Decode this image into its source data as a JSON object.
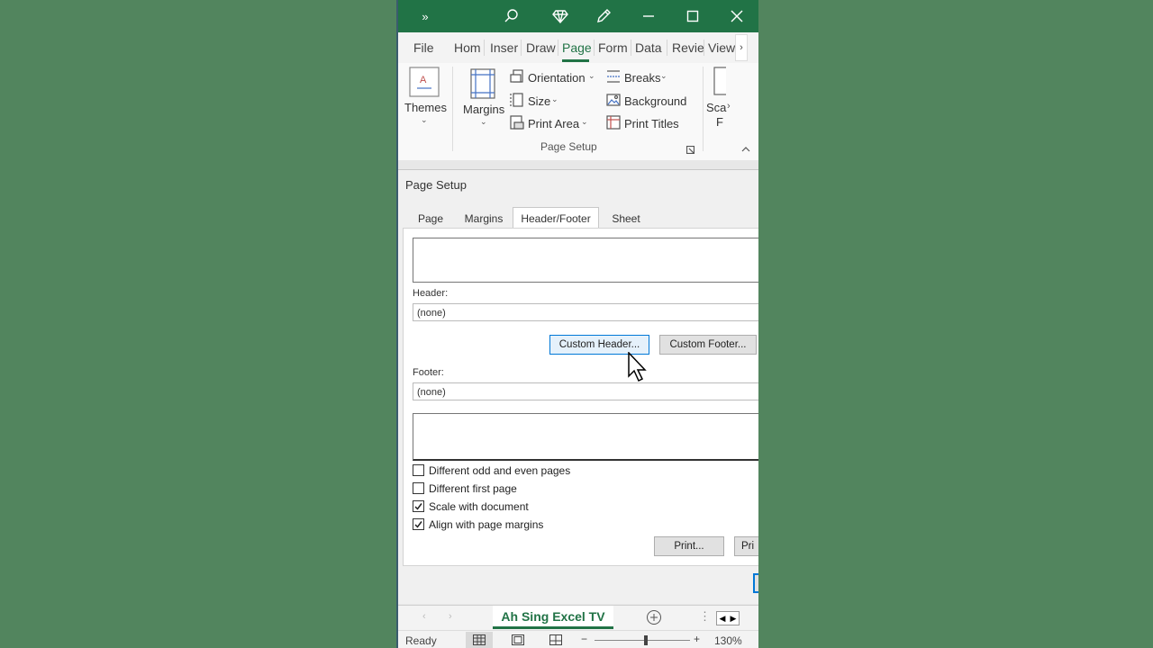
{
  "ribbon_tabs": [
    "File",
    "Hom",
    "Inser",
    "Draw",
    "Page",
    "Form",
    "Data",
    "Revie",
    "View"
  ],
  "ribbon": {
    "themes": "Themes",
    "margins": "Margins",
    "orientation": "Orientation",
    "size": "Size",
    "print_area": "Print Area",
    "breaks": "Breaks",
    "background": "Background",
    "print_titles": "Print Titles",
    "scale_partial_1": "Sca",
    "scale_partial_2": "F",
    "group_label": "Page Setup"
  },
  "dialog": {
    "title": "Page Setup",
    "tabs": [
      "Page",
      "Margins",
      "Header/Footer",
      "Sheet"
    ],
    "header_label": "Header:",
    "header_value": "(none)",
    "custom_header": "Custom Header...",
    "custom_footer": "Custom Footer...",
    "footer_label": "Footer:",
    "footer_value": "(none)",
    "options": [
      {
        "label": "Different odd and even pages",
        "checked": false
      },
      {
        "label": "Different first page",
        "checked": false
      },
      {
        "label": "Scale with document",
        "checked": true
      },
      {
        "label": "Align with page margins",
        "checked": true
      }
    ],
    "print_button": "Print...",
    "print_preview_partial": "Pri"
  },
  "sheet_tab": "Ah Sing Excel TV",
  "status": {
    "ready": "Ready",
    "zoom": "130%"
  },
  "colors": {
    "accent": "#217346",
    "background": "#52855e"
  }
}
